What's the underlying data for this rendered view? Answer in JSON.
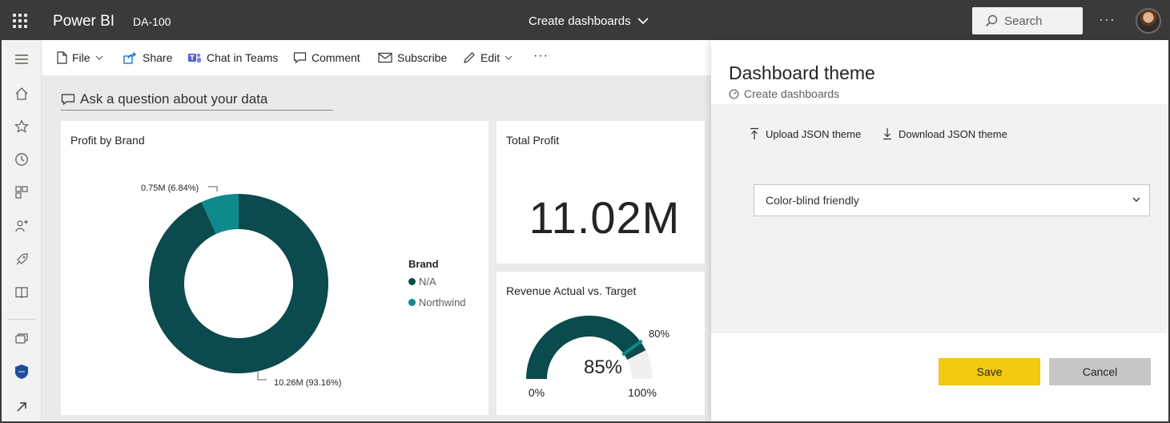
{
  "topbar": {
    "app_name": "Power BI",
    "workspace": "DA-100",
    "dashboard_title": "Create dashboards",
    "search_placeholder": "Search",
    "more": "···"
  },
  "nav": {
    "items": [
      "menu-icon",
      "home-icon",
      "favorites-icon",
      "recent-icon",
      "apps-icon",
      "shared-icon",
      "deployment-icon",
      "learn-icon",
      "workspaces-icon",
      "current-workspace-icon",
      "expand-icon"
    ]
  },
  "actions": {
    "file": "File",
    "share": "Share",
    "chat": "Chat in Teams",
    "comment": "Comment",
    "subscribe": "Subscribe",
    "edit": "Edit",
    "more": "···"
  },
  "qna": {
    "placeholder": "Ask a question about your data"
  },
  "tiles": {
    "profit_by_brand": {
      "title": "Profit by Brand",
      "legend_title": "Brand",
      "legend": [
        {
          "label": "N/A",
          "color": "#0b4a4d"
        },
        {
          "label": "Northwind",
          "color": "#0f8a8c"
        }
      ],
      "labels": {
        "small": "0.75M (6.84%)",
        "large": "10.26M (93.16%)"
      }
    },
    "total_profit": {
      "title": "Total Profit",
      "value": "11.02M"
    },
    "revenue": {
      "title": "Revenue Actual vs. Target",
      "value_label": "85%",
      "min_label": "0%",
      "max_label": "100%",
      "target_label": "80%"
    }
  },
  "chart_data": [
    {
      "type": "pie",
      "title": "Profit by Brand",
      "legend_title": "Brand",
      "categories": [
        "N/A",
        "Northwind"
      ],
      "values": [
        10.26,
        0.75
      ],
      "percentages": [
        93.16,
        6.84
      ],
      "colors": [
        "#0b4a4d",
        "#0f8a8c"
      ],
      "donut": true
    },
    {
      "type": "gauge",
      "title": "Revenue Actual vs. Target",
      "value": 85,
      "min": 0,
      "max": 100,
      "target": 80,
      "colors": {
        "fill": "#0b4a4d",
        "track": "#f0f0f0",
        "target": "#0f8a8c"
      }
    }
  ],
  "panel": {
    "title": "Dashboard theme",
    "subtitle": "Create dashboards",
    "upload": "Upload JSON theme",
    "download": "Download JSON theme",
    "theme_value": "Color-blind friendly",
    "save": "Save",
    "cancel": "Cancel"
  }
}
